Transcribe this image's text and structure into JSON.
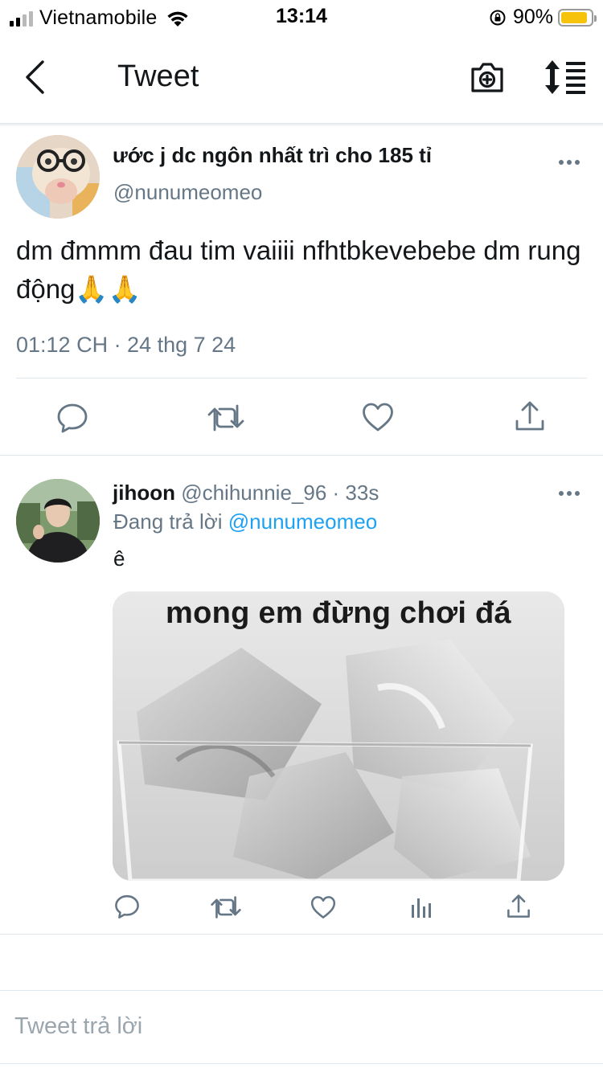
{
  "status_bar": {
    "carrier": "Vietnamobile",
    "time": "13:14",
    "battery_percent": "90%",
    "battery_level": 0.9,
    "battery_color": "#f6c20c",
    "signal_bars_filled": 2,
    "signal_bars_total": 4
  },
  "header": {
    "title": "Tweet",
    "icons": [
      "back-arrow-icon",
      "camera-plus-icon",
      "sort-icon"
    ]
  },
  "main_tweet": {
    "display_name": "ước j dc ngôn nhất trì cho 185 tỉ",
    "handle": "@nunumeomeo",
    "text": "dm đmmm đau tim vaiiii nfhtbkevebebe dm rung động🙏🙏",
    "timestamp": "01:12 CH · 24 thg 7 24",
    "actions": [
      "reply-icon",
      "retweet-icon",
      "like-icon",
      "share-icon"
    ]
  },
  "reply_tweet": {
    "display_name": "jihoon",
    "handle_time": " @chihunnie_96 · 33s",
    "replying_prefix": "Đang trả lời ",
    "replying_to": "@nunumeomeo",
    "text": "ê",
    "media_caption": "mong em đừng chơi đá",
    "actions": [
      "reply-icon",
      "retweet-icon",
      "like-icon",
      "analytics-icon",
      "share-icon"
    ]
  },
  "reply_box": {
    "placeholder": "Tweet trả lời"
  },
  "colors": {
    "accent": "#1da1f2",
    "secondary_text": "#657786",
    "primary_text": "#14171a",
    "divider": "#e1e8ed"
  }
}
